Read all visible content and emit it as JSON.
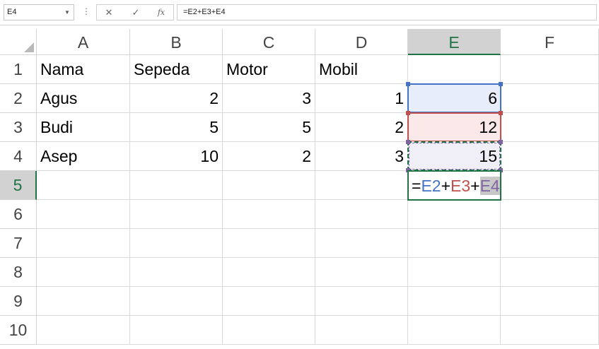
{
  "formula_bar": {
    "name_box": "E4",
    "dots": "⋮",
    "cancel_icon": "✕",
    "enter_icon": "✓",
    "fx_label": "fx",
    "formula": "=E2+E3+E4"
  },
  "columns": [
    "A",
    "B",
    "C",
    "D",
    "E",
    "F"
  ],
  "active_column": "E",
  "rows": [
    "1",
    "2",
    "3",
    "4",
    "5",
    "6",
    "7",
    "8",
    "9",
    "10"
  ],
  "active_row": "5",
  "cells": {
    "A1": "Nama",
    "B1": "Sepeda",
    "C1": "Motor",
    "D1": "Mobil",
    "A2": "Agus",
    "B2": "2",
    "C2": "3",
    "D2": "1",
    "E2": "6",
    "A3": "Budi",
    "B3": "5",
    "C3": "5",
    "D3": "2",
    "E3": "12",
    "A4": "Asep",
    "B4": "10",
    "C4": "2",
    "D4": "3",
    "E4": "15"
  },
  "editing_cell": {
    "eq": "=",
    "ref1": "E2",
    "plus1": "+",
    "ref2": "E3",
    "plus2": "+",
    "ref3": "E4"
  },
  "reference_colors": {
    "E2": "#4472c4",
    "E3": "#c0504d",
    "E4": "#8064a2",
    "active": "#217346"
  }
}
